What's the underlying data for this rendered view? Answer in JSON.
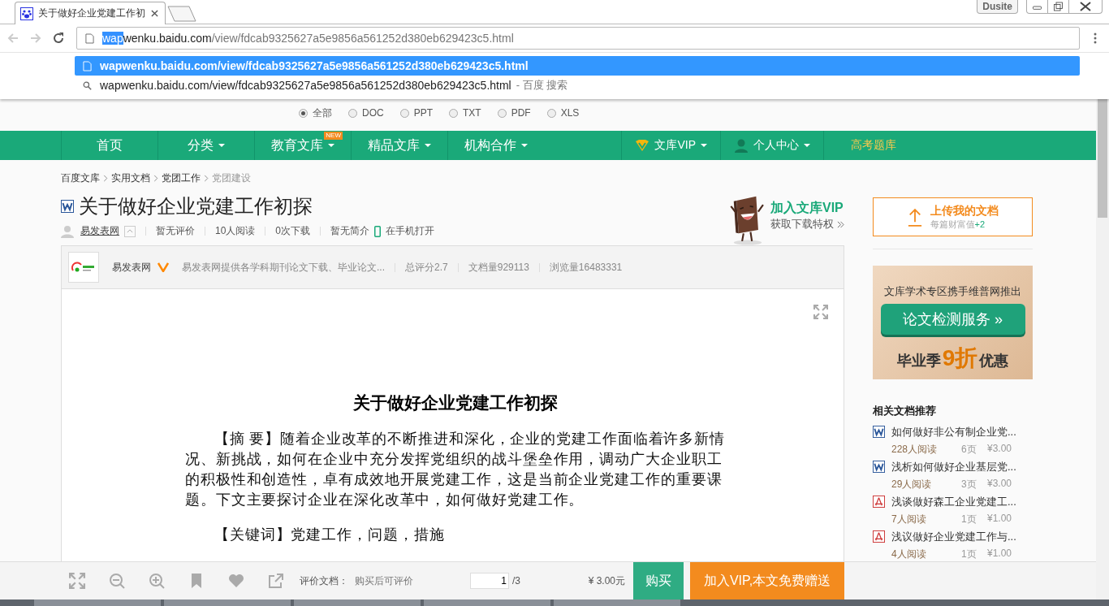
{
  "browser": {
    "tab": {
      "title": "关于做好企业党建工作初"
    },
    "user_label": "Dusite",
    "address": [
      {
        "kind": "selected",
        "text": "wap"
      },
      {
        "kind": "host",
        "text": "wenku.baidu.com"
      },
      {
        "kind": "path",
        "text": "/view/fdcab9325627a5e9856a561252d380eb629423c5.html"
      }
    ],
    "suggestions": [
      {
        "kind": "page",
        "text": "wapwenku.baidu.com/view/fdcab9325627a5e9856a561252d380eb629423c5.html",
        "selected": true
      },
      {
        "kind": "search",
        "text": "wapwenku.baidu.com/view/fdcab9325627a5e9856a561252d380eb629423c5.html",
        "suffix": "- 百度 搜索",
        "selected": false
      }
    ]
  },
  "filetypes": [
    {
      "label": "全部",
      "selected": true
    },
    {
      "label": "DOC",
      "selected": false
    },
    {
      "label": "PPT",
      "selected": false
    },
    {
      "label": "TXT",
      "selected": false
    },
    {
      "label": "PDF",
      "selected": false
    },
    {
      "label": "XLS",
      "selected": false
    }
  ],
  "nav": {
    "items": [
      {
        "label": "首页",
        "dropdown": false
      },
      {
        "label": "分类",
        "dropdown": true
      },
      {
        "label": "教育文库",
        "dropdown": true,
        "badge": "NEW"
      },
      {
        "label": "精品文库",
        "dropdown": true
      },
      {
        "label": "机构合作",
        "dropdown": true
      }
    ],
    "vip": "文库VIP",
    "personal": "个人中心",
    "exam": "高考题库"
  },
  "breadcrumb": [
    "百度文库",
    "实用文档",
    "党团工作",
    "党团建设"
  ],
  "doc": {
    "kind": "word",
    "title": "关于做好企业党建工作初探",
    "author": "易发表网",
    "meta": [
      "暂无评价",
      "10人阅读",
      "0次下载",
      "暂无简介"
    ],
    "mobile": "在手机打开"
  },
  "vip_promo": {
    "title": "加入文库VIP",
    "subtitle": "获取下载特权"
  },
  "author_card": {
    "name": "易发表网",
    "description": "易发表网提供各学科期刊论文下载、毕业论文...",
    "stats": [
      "总评分2.7",
      "文档量929113",
      "浏览量16483331"
    ]
  },
  "page": {
    "heading": "关于做好企业党建工作初探",
    "paragraphs": [
      "【摘  要】随着企业改革的不断推进和深化，企业的党建工作面临着许多新情况、新挑战，如何在企业中充分发挥党组织的战斗堡垒作用，调动广大企业职工的积极性和创造性，卓有成效地开展党建工作，这是当前企业党建工作的重要课题。下文主要探讨企业在深化改革中，如何做好党建工作。",
      "【关键词】党建工作，问题，措施"
    ]
  },
  "upload": {
    "title": "上传我的文档",
    "subtitle": "每篇财富值",
    "bonus": "+2"
  },
  "ad": {
    "line": "文库学术专区携手维普网推出",
    "button": "论文检测服务 »",
    "lead": "毕业季",
    "discount": "9折",
    "tail": "优惠"
  },
  "related": {
    "title": "相关文档推荐",
    "items": [
      {
        "kind": "word",
        "title": "如何做好非公有制企业党...",
        "reads": "228人阅读",
        "pages": "6页",
        "price": "¥3.00"
      },
      {
        "kind": "word",
        "title": "浅析如何做好企业基层党...",
        "reads": "29人阅读",
        "pages": "3页",
        "price": "¥3.00"
      },
      {
        "kind": "pdf",
        "title": "浅谈做好森工企业党建工...",
        "reads": "7人阅读",
        "pages": "1页",
        "price": "¥1.00"
      },
      {
        "kind": "pdf",
        "title": "浅议做好企业党建工作与...",
        "reads": "4人阅读",
        "pages": "1页",
        "price": "¥1.00"
      }
    ]
  },
  "toolbar": {
    "rate_label": "评价文档：",
    "rate_hint": "购买后可评价",
    "page": "1",
    "total": "/3",
    "price": "¥ 3.00元",
    "buy": "购买",
    "vip": "加入VIP,本文免费赠送"
  }
}
